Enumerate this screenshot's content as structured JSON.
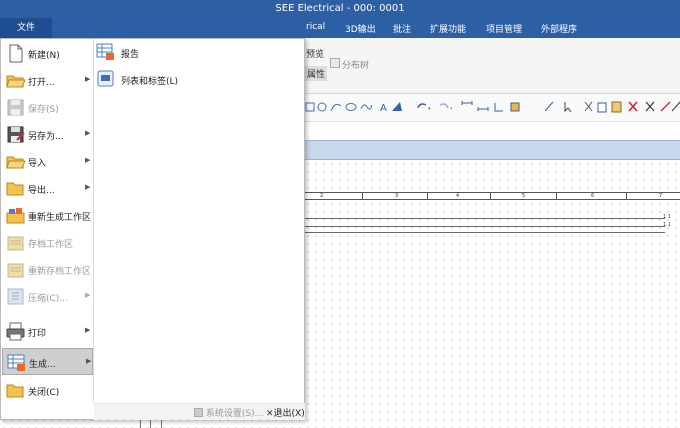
{
  "window": {
    "title": "SEE Electrical - 000: 0001"
  },
  "ribbon": {
    "file_tab": "文件",
    "tabs": [
      "rical",
      "3D输出",
      "批注",
      "扩展功能",
      "项目管理",
      "外部程序"
    ],
    "preview_label": "预览",
    "properties_label": "属性",
    "distribution_tree_label": "分布树"
  },
  "file_menu": {
    "items": [
      {
        "label": "新建(N)",
        "icon": "new-document-icon",
        "has_submenu": false,
        "enabled": true
      },
      {
        "label": "打开...",
        "icon": "folder-open-icon",
        "has_submenu": true,
        "enabled": true
      },
      {
        "label": "保存(S)",
        "icon": "save-icon",
        "has_submenu": false,
        "enabled": false
      },
      {
        "label": "另存为...",
        "icon": "save-as-icon",
        "has_submenu": true,
        "enabled": true
      },
      {
        "label": "导入",
        "icon": "import-icon",
        "has_submenu": true,
        "enabled": true
      },
      {
        "label": "导出...",
        "icon": "export-icon",
        "has_submenu": true,
        "enabled": true
      },
      {
        "label": "重新生成工作区",
        "icon": "regenerate-workspace-icon",
        "has_submenu": false,
        "enabled": true
      },
      {
        "label": "存档工作区",
        "icon": "archive-workspace-icon",
        "has_submenu": false,
        "enabled": false
      },
      {
        "label": "重新存档工作区",
        "icon": "rearchive-workspace-icon",
        "has_submenu": false,
        "enabled": false
      },
      {
        "label": "压缩(C)...",
        "icon": "compress-icon",
        "has_submenu": true,
        "enabled": false
      },
      {
        "label": "打印",
        "icon": "printer-icon",
        "has_submenu": true,
        "enabled": true
      },
      {
        "label": "生成...",
        "icon": "generate-icon",
        "has_submenu": true,
        "enabled": true,
        "selected": true
      },
      {
        "label": "关闭(C)",
        "icon": "close-folder-icon",
        "has_submenu": false,
        "enabled": true
      }
    ],
    "submenu": [
      {
        "label": "报告",
        "icon": "report-icon"
      },
      {
        "label": "列表和标签(L)",
        "icon": "list-labels-icon"
      }
    ],
    "system_settings_label": "系统设置(S)...",
    "exit_label": "退出(X)"
  },
  "drawing": {
    "ruler_labels": [
      "2",
      "3",
      "4",
      "5",
      "6",
      "7"
    ],
    "terminal_labels": [
      "1.1",
      "1.1"
    ]
  }
}
